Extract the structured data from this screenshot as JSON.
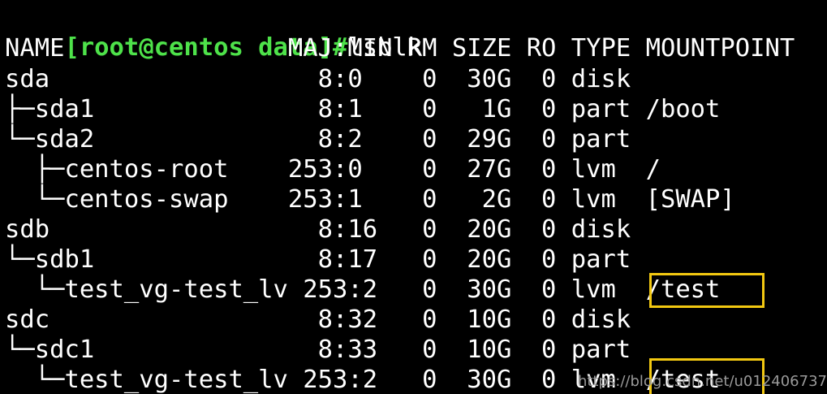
{
  "prompt": {
    "user_host": "[root@centos data]#",
    "command": "lsblk"
  },
  "output": {
    "header": "NAME               MAJ:MIN RM SIZE RO TYPE MOUNTPOINT",
    "rows": [
      "sda                  8:0    0  30G  0 disk",
      "├─sda1               8:1    0   1G  0 part /boot",
      "└─sda2               8:2    0  29G  0 part",
      "  ├─centos-root    253:0    0  27G  0 lvm  /",
      "  └─centos-swap    253:1    0   2G  0 lvm  [SWAP]",
      "sdb                  8:16   0  20G  0 disk",
      "└─sdb1               8:17   0  20G  0 part",
      "  └─test_vg-test_lv 253:2   0  30G  0 lvm  /test",
      "sdc                  8:32   0  10G  0 disk",
      "└─sdc1               8:33   0  10G  0 part",
      "  └─test_vg-test_lv 253:2   0  30G  0 lvm  /test"
    ]
  },
  "annotations": {
    "highlight_color": "#f2c811",
    "prompt_color": "#4ee24a",
    "background_color": "#000000",
    "text_color": "#ffffff"
  },
  "watermark": "https://blog.csdn.net/u012406737"
}
